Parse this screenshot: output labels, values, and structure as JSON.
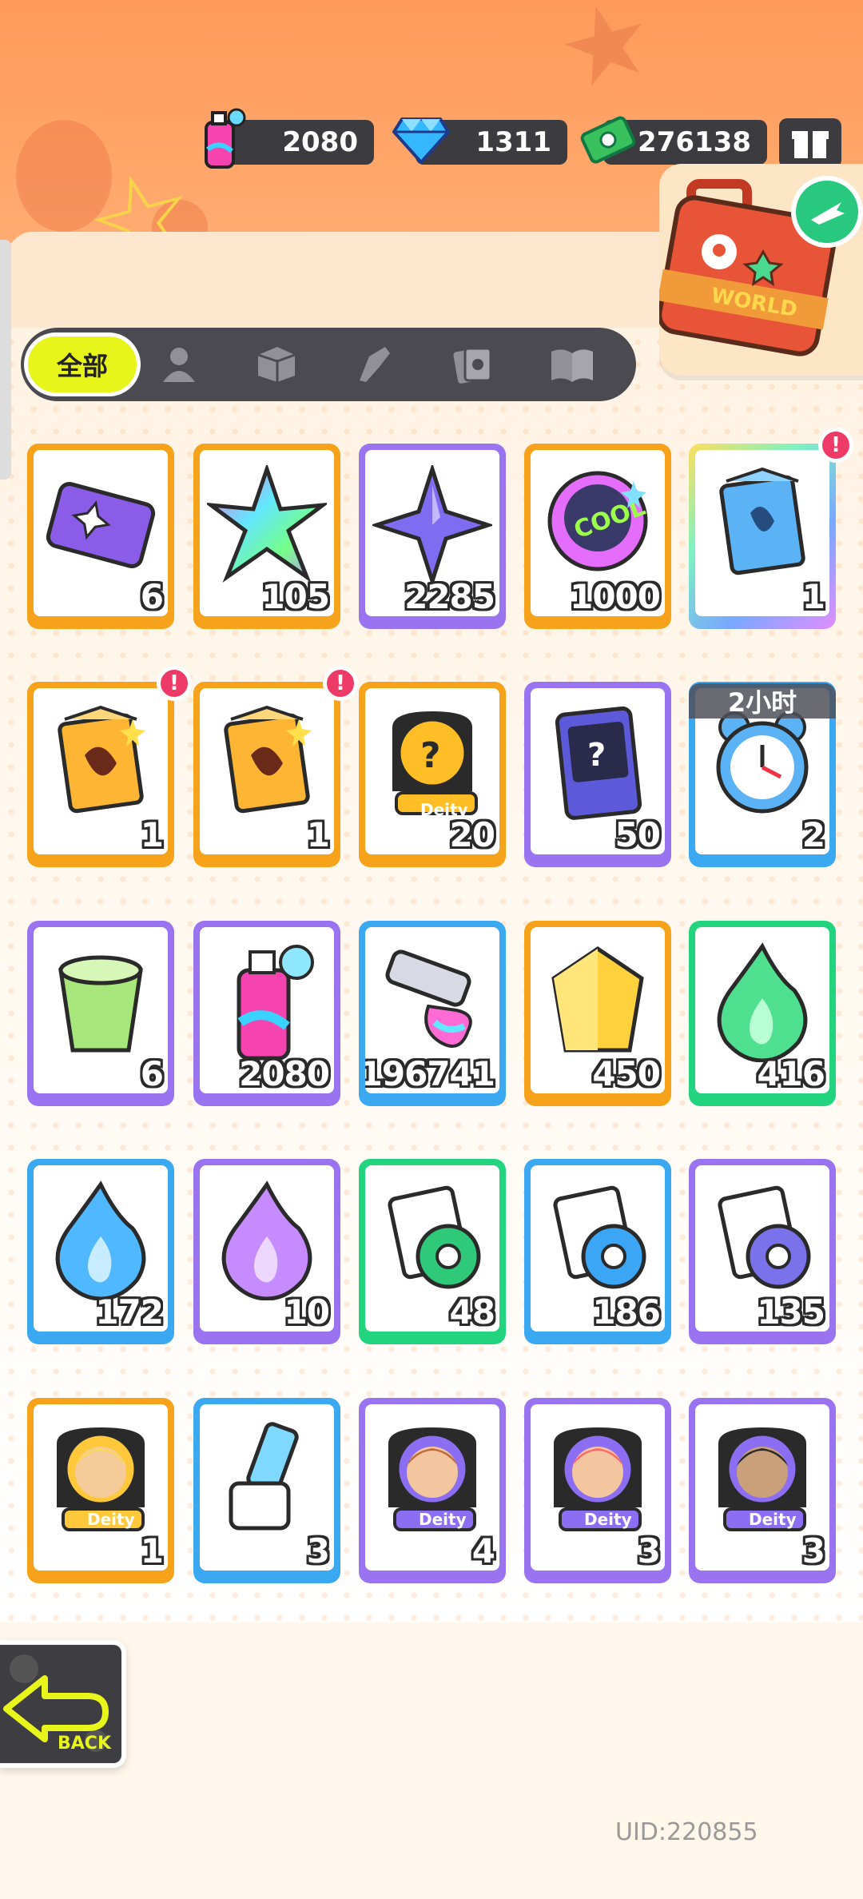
{
  "currencies": [
    {
      "name": "spray-paint",
      "value": "2080"
    },
    {
      "name": "diamond",
      "value": "1311"
    },
    {
      "name": "cash",
      "value": "276138"
    }
  ],
  "world_card": {
    "label": "WORLD"
  },
  "filter": {
    "active_label": "全部",
    "tabs": [
      "character-icon",
      "box-icon",
      "spray-icon",
      "card-icon",
      "book-icon"
    ]
  },
  "items": [
    {
      "name": "ticket",
      "count": "6",
      "frame": "orange",
      "badge": false
    },
    {
      "name": "rainbow-star",
      "count": "105",
      "frame": "orange",
      "badge": false
    },
    {
      "name": "purple-star",
      "count": "2285",
      "frame": "purple",
      "badge": false
    },
    {
      "name": "cool-badge",
      "count": "1000",
      "frame": "orange",
      "badge": false
    },
    {
      "name": "deity-box-blue",
      "count": "1",
      "frame": "rainbow",
      "badge": true
    },
    {
      "name": "deity-box-orange",
      "count": "1",
      "frame": "orange",
      "badge": true
    },
    {
      "name": "deity-box-orange-2",
      "count": "1",
      "frame": "orange",
      "badge": true
    },
    {
      "name": "mystery-deity",
      "count": "20",
      "frame": "orange",
      "badge": false
    },
    {
      "name": "mystery-travel-card",
      "count": "50",
      "frame": "purple",
      "badge": false
    },
    {
      "name": "alarm-clock",
      "count": "2",
      "frame": "blue",
      "badge": false
    },
    {
      "name": "green-cup",
      "count": "6",
      "frame": "purple",
      "badge": false
    },
    {
      "name": "spray-can",
      "count": "2080",
      "frame": "purple",
      "badge": false
    },
    {
      "name": "paint-tube",
      "count": "196741",
      "frame": "blue",
      "badge": false
    },
    {
      "name": "gold-gem",
      "count": "450",
      "frame": "orange",
      "badge": false
    },
    {
      "name": "green-flame",
      "count": "416",
      "frame": "green",
      "badge": false
    },
    {
      "name": "blue-flame",
      "count": "172",
      "frame": "blue",
      "badge": false
    },
    {
      "name": "purple-flame",
      "count": "10",
      "frame": "purple",
      "badge": false
    },
    {
      "name": "green-tape",
      "count": "48",
      "frame": "green",
      "badge": false
    },
    {
      "name": "blue-tape",
      "count": "186",
      "frame": "blue",
      "badge": false
    },
    {
      "name": "purple-tape",
      "count": "135",
      "frame": "purple",
      "badge": false
    },
    {
      "name": "deity-gold",
      "count": "1",
      "frame": "orange",
      "badge": false
    },
    {
      "name": "usb-key",
      "count": "3",
      "frame": "blue",
      "badge": false
    },
    {
      "name": "deity-boy",
      "count": "4",
      "frame": "purple",
      "badge": false
    },
    {
      "name": "deity-girl",
      "count": "3",
      "frame": "purple",
      "badge": false
    },
    {
      "name": "deity-green",
      "count": "3",
      "frame": "purple",
      "badge": false
    }
  ],
  "deity_label": "Deity",
  "cool_label": "COOL",
  "timer_label": "2小时",
  "back_label": "BACK",
  "uid": "UID:220855"
}
